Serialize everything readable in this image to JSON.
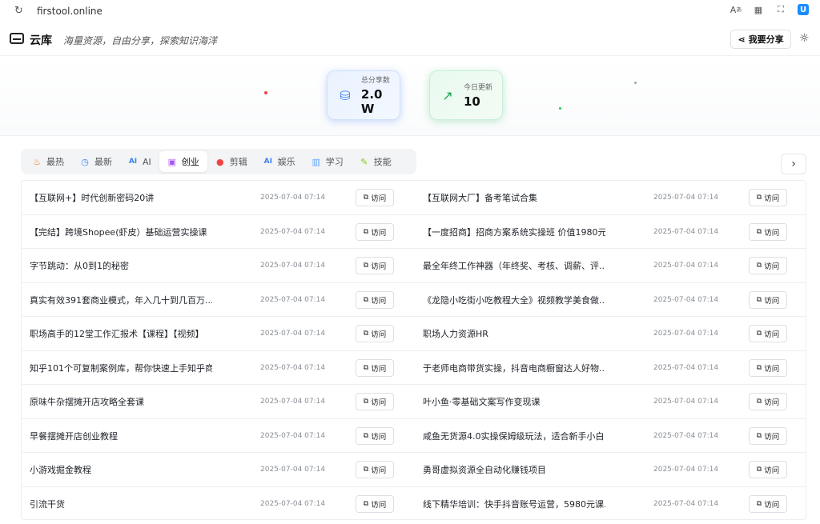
{
  "browser": {
    "url": "firstool.online",
    "ext_label": "U"
  },
  "header": {
    "logo_text": "云库",
    "slogan": "海量资源，自由分享，探索知识海洋",
    "share_label": "我要分享"
  },
  "stats": [
    {
      "label": "总分享数",
      "value": "2.0 W",
      "icon": "database-icon",
      "color": "#3b82f6"
    },
    {
      "label": "今日更新",
      "value": "10",
      "icon": "trending-up-icon",
      "color": "#16a34a"
    }
  ],
  "tabs": [
    {
      "label": "最热",
      "icon": "flame-icon",
      "active": false
    },
    {
      "label": "最新",
      "icon": "clock-icon",
      "active": false
    },
    {
      "label": "AI",
      "icon": "ai-icon",
      "active": false
    },
    {
      "label": "创业",
      "icon": "startup-icon",
      "active": true
    },
    {
      "label": "剪辑",
      "icon": "record-icon",
      "active": false
    },
    {
      "label": "娱乐",
      "icon": "ai-icon",
      "active": false
    },
    {
      "label": "学习",
      "icon": "book-icon",
      "active": false
    },
    {
      "label": "技能",
      "icon": "tool-icon",
      "active": false
    }
  ],
  "visit_label": "访问",
  "rows": [
    {
      "left": {
        "title": "【互联网+】时代创新密码20讲",
        "date": "2025-07-04 07:14"
      },
      "right": {
        "title": "【互联网大厂】备考笔试合集",
        "date": "2025-07-04 07:14"
      }
    },
    {
      "left": {
        "title": "【完结】跨境Shopee(虾皮）基础运营实操课",
        "date": "2025-07-04 07:14"
      },
      "right": {
        "title": "【一度招商】招商方案系统实操班 价值1980元",
        "date": "2025-07-04 07:14"
      }
    },
    {
      "left": {
        "title": "字节跳动：从0到1的秘密",
        "date": "2025-07-04 07:14"
      },
      "right": {
        "title": "最全年终工作神器（年终奖、考核、调薪、评...",
        "date": "2025-07-04 07:14"
      }
    },
    {
      "left": {
        "title": "真实有效391套商业模式，年入几十到几百万...",
        "date": "2025-07-04 07:14"
      },
      "right": {
        "title": "《龙隐小吃街小吃教程大全》视频教学美食做...",
        "date": "2025-07-04 07:14"
      }
    },
    {
      "left": {
        "title": "职场高手的12堂工作汇报术【课程】【视频】",
        "date": "2025-07-04 07:14"
      },
      "right": {
        "title": "职场人力资源HR",
        "date": "2025-07-04 07:14"
      }
    },
    {
      "left": {
        "title": "知乎101个可复制案例库，帮你快速上手知乎商...",
        "date": "2025-07-04 07:14"
      },
      "right": {
        "title": "于老师电商带货实操，抖音电商橱窗达人好物...",
        "date": "2025-07-04 07:14"
      }
    },
    {
      "left": {
        "title": "原味牛杂摆摊开店攻略全套课",
        "date": "2025-07-04 07:14"
      },
      "right": {
        "title": "叶小鱼·零基础文案写作变现课",
        "date": "2025-07-04 07:14"
      }
    },
    {
      "left": {
        "title": "早餐摆摊开店创业教程",
        "date": "2025-07-04 07:14"
      },
      "right": {
        "title": "咸鱼无货源4.0实操保姆级玩法，适合新手小白",
        "date": "2025-07-04 07:14"
      }
    },
    {
      "left": {
        "title": "小游戏掘金教程",
        "date": "2025-07-04 07:14"
      },
      "right": {
        "title": "勇哥虚拟资源全自动化赚钱项目",
        "date": "2025-07-04 07:14"
      }
    },
    {
      "left": {
        "title": "引流干货",
        "date": "2025-07-04 07:14"
      },
      "right": {
        "title": "线下精华培训：快手抖音账号运营，5980元课...",
        "date": "2025-07-04 07:14"
      }
    }
  ]
}
